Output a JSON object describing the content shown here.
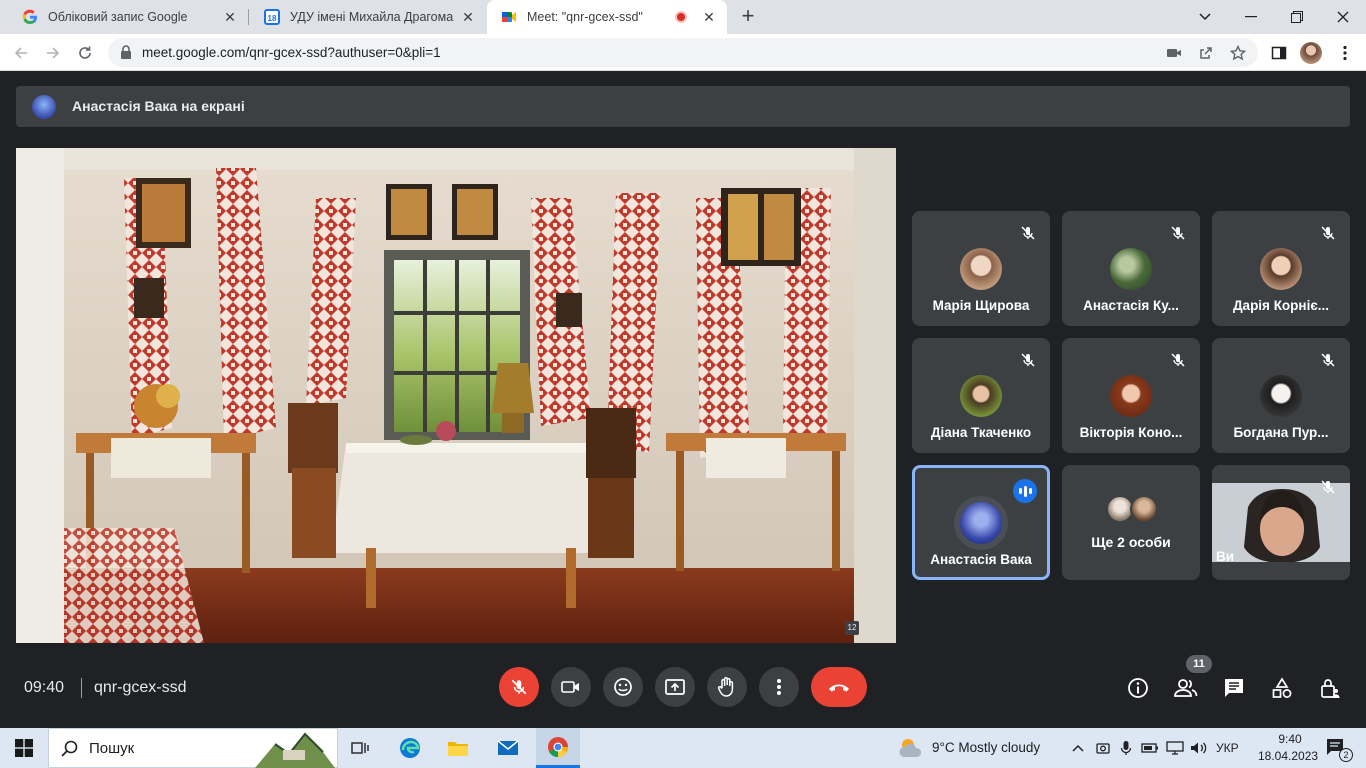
{
  "browser": {
    "tabs": [
      {
        "label": "Обліковий запис Google",
        "active": false,
        "icon": "google-icon"
      },
      {
        "label": "УДУ імені Михайла Драгоманова",
        "active": false,
        "icon": "calendar-icon"
      },
      {
        "label": "Meet: \"qnr-gcex-ssd\"",
        "active": true,
        "icon": "meet-icon",
        "recording": true
      }
    ],
    "url": "meet.google.com/qnr-gcex-ssd?authuser=0&pli=1"
  },
  "meet": {
    "presenting_banner": "Анастасія Вака на екрані",
    "participants": [
      {
        "name": "Марія Щирова",
        "muted": true,
        "avatar_color": "#d9b49c"
      },
      {
        "name": "Анастасія Ку...",
        "muted": true,
        "avatar_color": "#5f7a4e"
      },
      {
        "name": "Дарія Корніє...",
        "muted": true,
        "avatar_color": "#b58f76"
      },
      {
        "name": "Діана Ткаченко",
        "muted": true,
        "avatar_color": "#6f8f3e"
      },
      {
        "name": "Вікторія Коно...",
        "muted": true,
        "avatar_color": "#8a4a2c"
      },
      {
        "name": "Богдана Пур...",
        "muted": true,
        "avatar_color": "#2e2e2e"
      },
      {
        "name": "Анастасія Вака",
        "muted": false,
        "speaking": true,
        "avatar_color": "#3949ab"
      },
      {
        "name": "Ще 2 особи",
        "muted": false
      },
      {
        "name": "Ви",
        "muted": true,
        "video": true
      }
    ],
    "slide_number": "12",
    "time": "09:40",
    "meeting_code": "qnr-gcex-ssd",
    "participants_count": "11",
    "accent_red": "#ea4335",
    "speaking_blue": "#8ab4f8"
  },
  "taskbar": {
    "search_label": "Пошук",
    "weather": "9°C  Mostly cloudy",
    "language": "УКР",
    "time": "9:40",
    "date": "18.04.2023",
    "notifications": "2"
  }
}
